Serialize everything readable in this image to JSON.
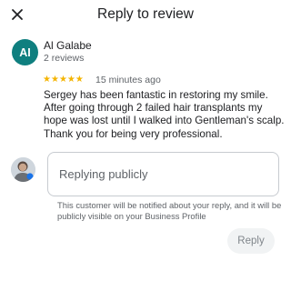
{
  "header": {
    "title": "Reply to review",
    "close_icon": "close-icon"
  },
  "review": {
    "avatar_initials": "AI",
    "avatar_color": "#0f7f7f",
    "reviewer_name": "Al Galabe",
    "reviewer_meta": "2 reviews",
    "rating": 5,
    "star_color": "#f4b400",
    "time": "15 minutes ago",
    "text": "Sergey has been fantastic in restoring my smile. After going through 2 failed hair transplants my hope was lost until I walked into Gentleman's scalp. Thank you for being very professional."
  },
  "reply": {
    "avatar_icon": "user-avatar-icon",
    "placeholder": "Replying publicly",
    "value": "",
    "notice": "This customer will be notified about your reply, and it will be publicly visible on your Business Profile",
    "button_label": "Reply"
  }
}
